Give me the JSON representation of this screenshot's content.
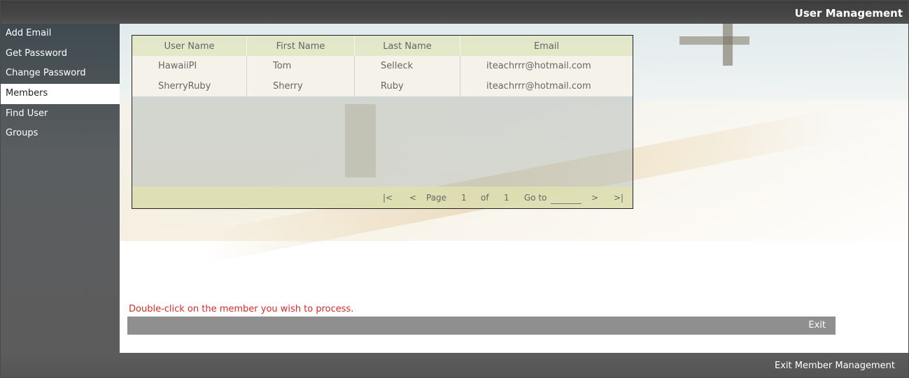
{
  "header": {
    "title": "User Management"
  },
  "sidebar": {
    "items": [
      {
        "label": "Add Email",
        "active": false
      },
      {
        "label": "Get Password",
        "active": false
      },
      {
        "label": "Change Password",
        "active": false
      },
      {
        "label": "Members",
        "active": true
      },
      {
        "label": "Find User",
        "active": false
      },
      {
        "label": "Groups",
        "active": false
      }
    ]
  },
  "grid": {
    "columns": [
      "User Name",
      "First Name",
      "Last Name",
      "Email"
    ],
    "rows": [
      [
        "HawaiiPI",
        "Tom",
        "Selleck",
        "iteachrrr@hotmail.com"
      ],
      [
        "SherryRuby",
        "Sherry",
        "Ruby",
        "iteachrrr@hotmail.com"
      ]
    ],
    "pager": {
      "first": "|<",
      "prev": "<",
      "page_label": "Page",
      "current": "1",
      "of_label": "of",
      "total": "1",
      "goto_label": "Go to",
      "goto_value": "",
      "next": ">",
      "last": ">|"
    }
  },
  "hint": "Double-click on the member you wish to process.",
  "exit_label": "Exit",
  "footer": {
    "exit_member_management": "Exit Member Management"
  }
}
